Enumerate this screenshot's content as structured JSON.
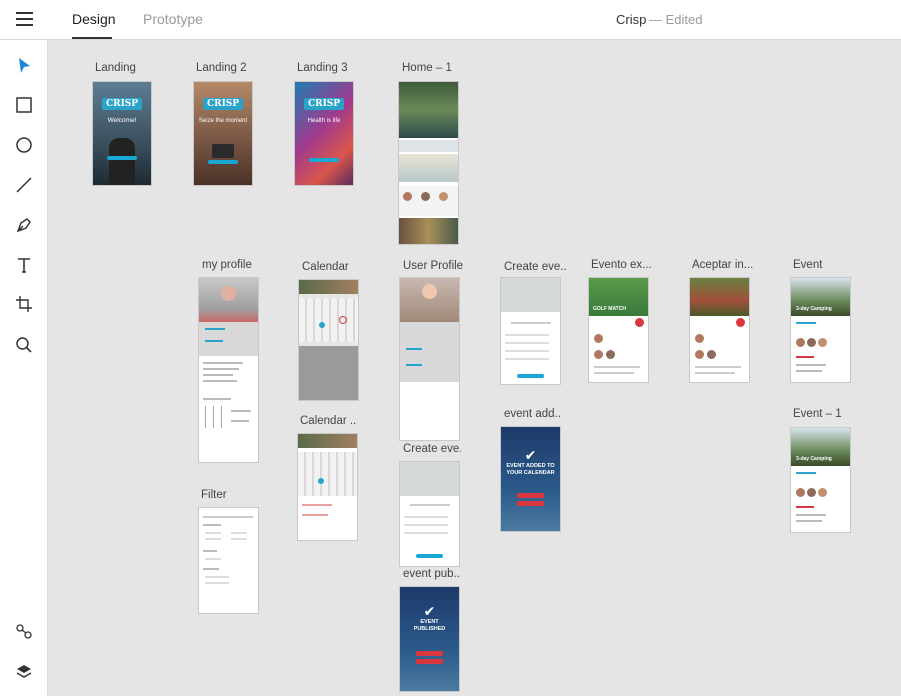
{
  "topbar": {
    "tabs": [
      {
        "label": "Design"
      },
      {
        "label": "Prototype"
      }
    ],
    "doc_title": "Crisp",
    "doc_status": "— Edited"
  },
  "tools": [
    {
      "icon": "select-arrow-icon"
    },
    {
      "icon": "rectangle-icon"
    },
    {
      "icon": "ellipse-icon"
    },
    {
      "icon": "line-icon"
    },
    {
      "icon": "pen-icon"
    },
    {
      "icon": "text-icon"
    },
    {
      "icon": "artboard-icon"
    },
    {
      "icon": "zoom-icon"
    },
    {
      "icon": "assets-icon"
    },
    {
      "icon": "layers-icon"
    }
  ],
  "artboards": [
    {
      "label": "Landing"
    },
    {
      "label": "Landing 2"
    },
    {
      "label": "Landing 3"
    },
    {
      "label": "Home – 1"
    },
    {
      "label": "my profile"
    },
    {
      "label": "Calendar"
    },
    {
      "label": "User Profile"
    },
    {
      "label": "Create eve..."
    },
    {
      "label": "Evento ex..."
    },
    {
      "label": "Aceptar in..."
    },
    {
      "label": "Event"
    },
    {
      "label": "Calendar ..."
    },
    {
      "label": "Create eve..."
    },
    {
      "label": "event add..."
    },
    {
      "label": "Event – 1"
    },
    {
      "label": "Filter"
    },
    {
      "label": "event pub..."
    }
  ],
  "thumb_text": {
    "crisp_logo": "CRISP",
    "landing_msg": "Welcome!",
    "landing2_msg": "Seize the moment",
    "landing3_msg": "Health is life",
    "event_added": "EVENT ADDED TO YOUR CALENDAR",
    "event_published": "EVENT PUBLISHED",
    "golf_title": "GOLF MATCH",
    "event_title": "3-day Camping"
  },
  "colors": {
    "accent": "#19a7d6",
    "danger": "#d9363e",
    "canvas": "#e5e5e5"
  }
}
